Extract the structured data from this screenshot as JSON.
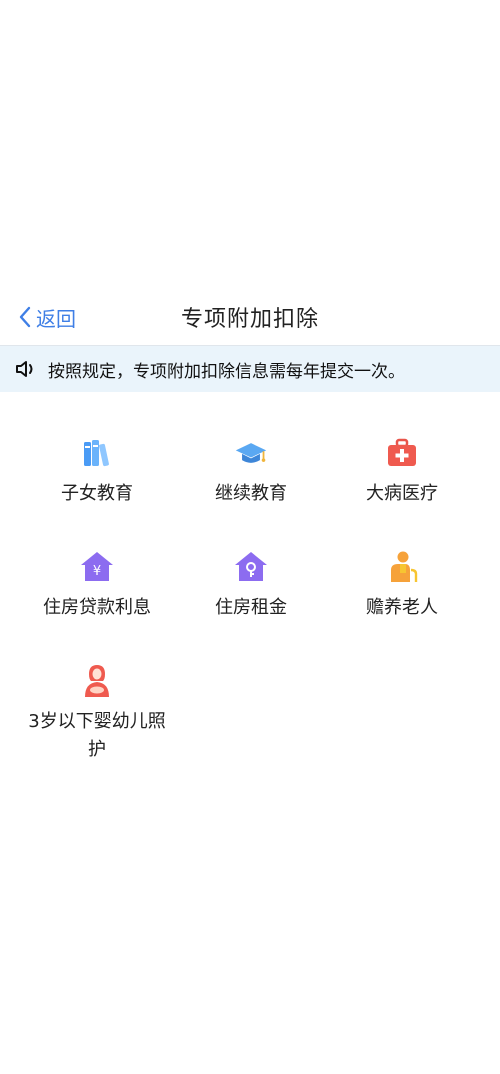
{
  "nav": {
    "back_label": "返回",
    "title": "专项附加扣除"
  },
  "notice": {
    "text": "按照规定，专项附加扣除信息需每年提交一次。"
  },
  "items": [
    {
      "label": "子女教育",
      "icon": "books-icon"
    },
    {
      "label": "继续教育",
      "icon": "graduation-cap-icon"
    },
    {
      "label": "大病医疗",
      "icon": "first-aid-kit-icon"
    },
    {
      "label": "住房贷款利息",
      "icon": "house-yuan-icon"
    },
    {
      "label": "住房租金",
      "icon": "house-key-icon"
    },
    {
      "label": "赡养老人",
      "icon": "elderly-person-icon"
    },
    {
      "label": "3岁以下婴幼儿照护",
      "icon": "mother-baby-icon"
    }
  ],
  "colors": {
    "accent": "#3f7fe6",
    "notice_bg": "#eaf4fb",
    "purple": "#8c6cf0",
    "red": "#ef5a4f",
    "orange": "#f6a23a"
  }
}
